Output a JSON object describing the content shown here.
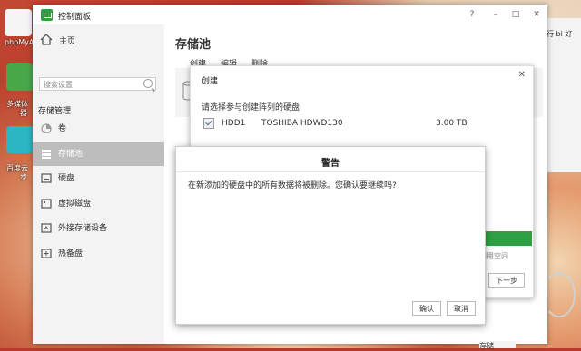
{
  "desktop": {
    "labels": [
      "phpMyA",
      "多媒体",
      "器",
      "百度云",
      "步",
      "丁",
      "行 bi 好"
    ]
  },
  "window": {
    "title": "控制面板",
    "controls": [
      "?",
      "–",
      "□",
      "✕"
    ]
  },
  "sidebar": {
    "home_label": "主页",
    "search_placeholder": "搜索设置",
    "section_title": "存储管理",
    "items": [
      {
        "label": "卷",
        "icon": "pie-chart-icon"
      },
      {
        "label": "存储池",
        "icon": "storage-pool-icon"
      },
      {
        "label": "硬盘",
        "icon": "disk-icon"
      },
      {
        "label": "虚拟磁盘",
        "icon": "virtual-disk-icon"
      },
      {
        "label": "外接存储设备",
        "icon": "external-storage-icon"
      },
      {
        "label": "热备盘",
        "icon": "hot-spare-icon"
      }
    ]
  },
  "main": {
    "title": "存储池",
    "toolbar": [
      "创建",
      "编辑",
      "删除"
    ]
  },
  "create_dialog": {
    "title": "创建",
    "close": "✕",
    "subtitle": "请选择参与创建阵列的硬盘",
    "disks": [
      {
        "name": "HDD1",
        "model": "TOSHIBA HDWD130",
        "size": "3.00 TB",
        "checked": true
      }
    ],
    "clipped_text": "利用空间",
    "next_button": "下一步"
  },
  "warning_dialog": {
    "title": "警告",
    "message": "在新添加的硬盘中的所有数据将被删除。您确认要继续吗?",
    "confirm": "确认",
    "cancel": "取消"
  },
  "bottom_label": "存储",
  "colors": {
    "accent": "#2ea043",
    "sidebar_active": "#bdbdbd"
  }
}
